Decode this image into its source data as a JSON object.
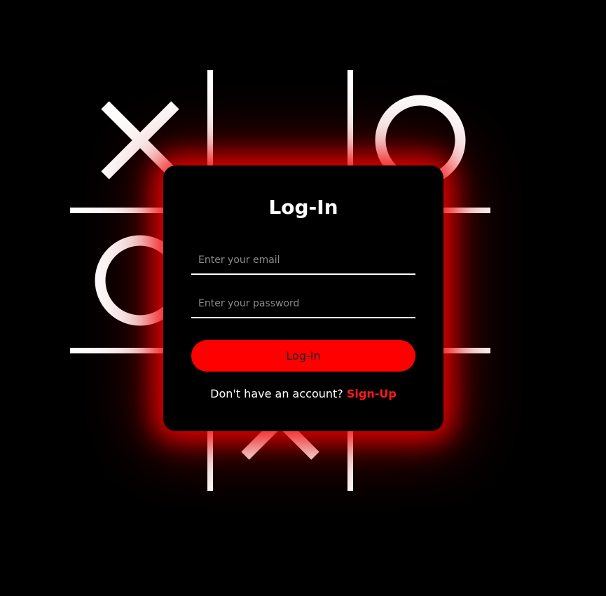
{
  "colors": {
    "background": "#000000",
    "accent": "#ff0000",
    "glow": "#ff0000",
    "card": "#000000",
    "text": "#ffffff",
    "placeholder": "#8a8a8a",
    "link": "#ff1a1a"
  },
  "background_board": {
    "game": "tic-tac-toe",
    "cells": [
      "X",
      "",
      "O",
      "O",
      "",
      "",
      "",
      "X",
      ""
    ],
    "icons": [
      "x-mark-icon",
      "o-mark-icon"
    ]
  },
  "login": {
    "title": "Log-In",
    "email_placeholder": "Enter your email",
    "email_value": "",
    "password_placeholder": "Enter your password",
    "password_value": "",
    "submit_label": "Log-In",
    "signup_prompt": "Don't have an account?",
    "signup_link": "Sign-Up"
  }
}
